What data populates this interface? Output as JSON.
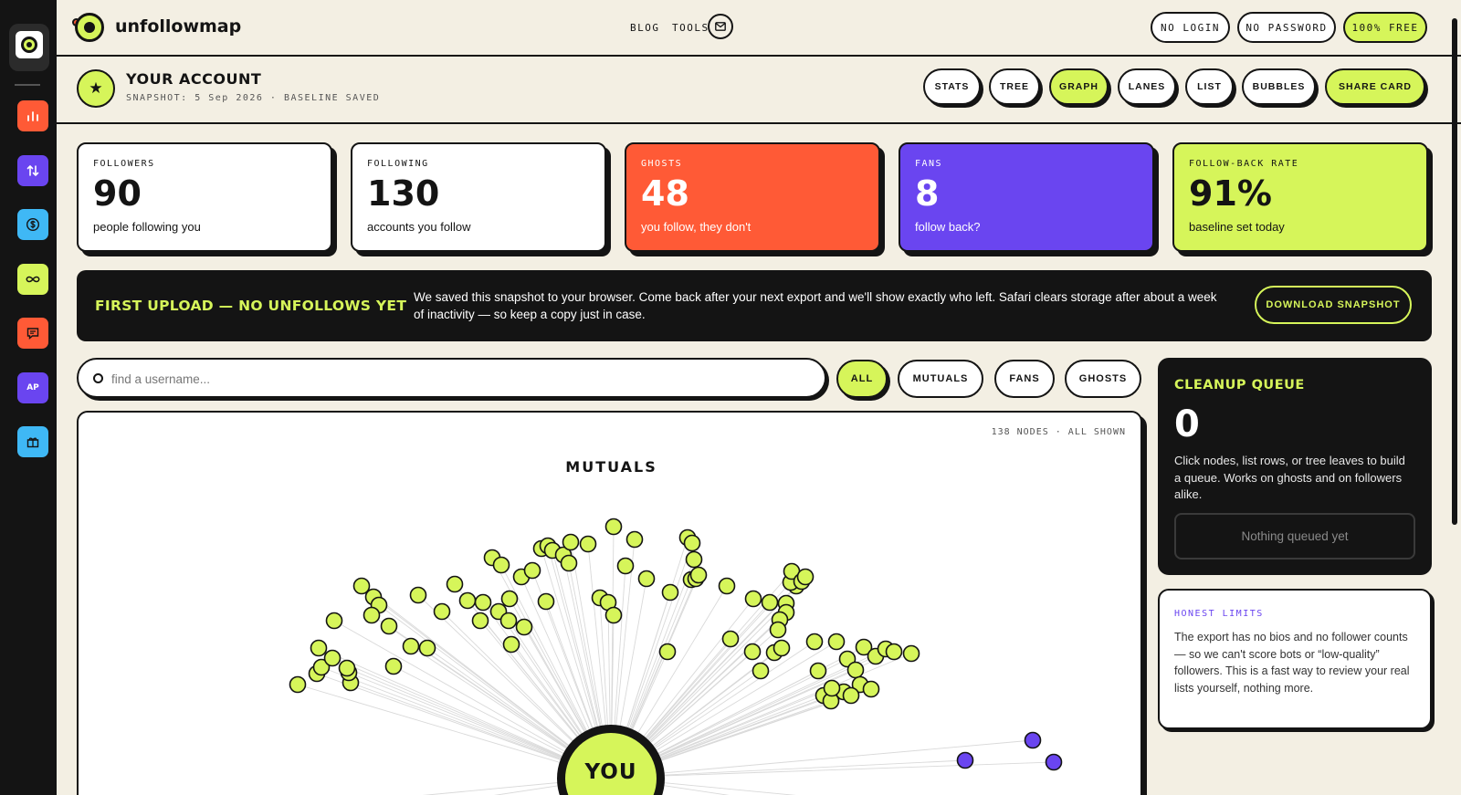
{
  "brand": {
    "name": "unfollowmap"
  },
  "nav": {
    "blog": "BLOG",
    "tools": "TOOLS",
    "mail_icon": "mail-icon"
  },
  "top_pills": {
    "no_login": "NO LOGIN",
    "no_password": "NO PASSWORD",
    "free": "100% FREE"
  },
  "rail": {
    "items": [
      {
        "icon": "bar-chart-icon",
        "color": "#ff5a36"
      },
      {
        "icon": "arrows-up-down-icon",
        "color": "#6a45f0"
      },
      {
        "icon": "dollar-icon",
        "color": "#3fb8f5"
      },
      {
        "icon": "infinity-icon",
        "color": "#d6f55a"
      },
      {
        "icon": "chat-icon",
        "color": "#ff5a36"
      },
      {
        "icon": "ap-icon",
        "label": "AP",
        "color": "#6a45f0"
      },
      {
        "icon": "gift-icon",
        "color": "#3fb8f5"
      }
    ]
  },
  "account": {
    "star": "★",
    "title": "YOUR ACCOUNT",
    "subtitle": "SNAPSHOT: 5 Sep 2026 · BASELINE SAVED"
  },
  "view_tabs": {
    "stats": "STATS",
    "tree": "TREE",
    "graph": "GRAPH",
    "lanes": "LANES",
    "list": "LIST",
    "bubbles": "BUBBLES",
    "share": "SHARE CARD",
    "active": "graph"
  },
  "stats": {
    "followers": {
      "label": "FOLLOWERS",
      "value": "90",
      "desc": "people following you"
    },
    "following": {
      "label": "FOLLOWING",
      "value": "130",
      "desc": "accounts you follow"
    },
    "ghosts": {
      "label": "GHOSTS",
      "value": "48",
      "desc": "you follow, they don't"
    },
    "fans": {
      "label": "FANS",
      "value": "8",
      "desc": "follow back?"
    },
    "rate": {
      "label": "FOLLOW-BACK RATE",
      "value": "91%",
      "desc": "baseline set today"
    }
  },
  "banner": {
    "title": "FIRST UPLOAD — NO UNFOLLOWS YET",
    "text": "We saved this snapshot to your browser. Come back after your next export and we'll show exactly who left. Safari clears storage after about a week of inactivity — so keep a copy just in case.",
    "button": "DOWNLOAD SNAPSHOT"
  },
  "search": {
    "placeholder": "find a username..."
  },
  "filters": {
    "all": "ALL",
    "mutuals": "MUTUALS",
    "fans": "FANS",
    "ghosts": "GHOSTS",
    "active": "all"
  },
  "graph": {
    "meta": "138 NODES · ALL SHOWN",
    "title": "MUTUALS",
    "center": "YOU",
    "colors": {
      "mutual": "#d6f55a",
      "fan": "#6a45f0",
      "stroke": "#141414",
      "edge": "#d9d9d9"
    }
  },
  "queue": {
    "title": "CLEANUP QUEUE",
    "count": "0",
    "desc": "Click nodes, list rows, or tree leaves to build a queue. Works on ghosts and on followers alike.",
    "empty": "Nothing queued yet"
  },
  "limits": {
    "title": "HONEST LIMITS",
    "text": "The export has no bios and no follower counts — so we can't score bots or “low-quality” followers. This is a fast way to review your real lists yourself, nothing more."
  },
  "colors": {
    "bg": "#f3efe3",
    "ink": "#141414",
    "lime": "#d6f55a",
    "red": "#ff5a36",
    "purple": "#6a45f0",
    "blue": "#3fb8f5"
  }
}
